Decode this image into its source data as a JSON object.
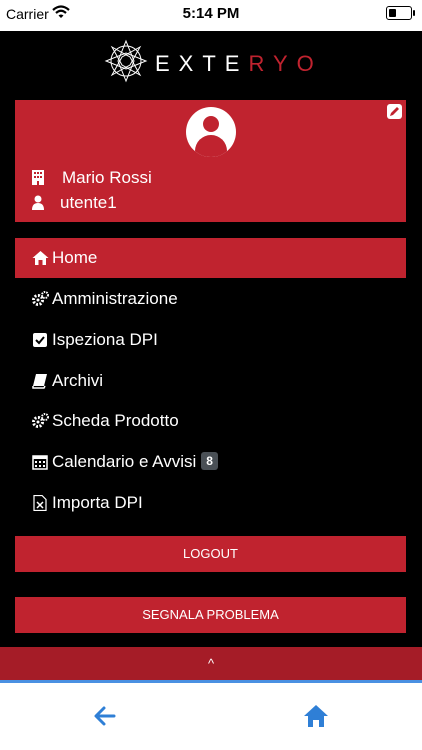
{
  "status_bar": {
    "carrier": "Carrier",
    "time": "5:14 PM",
    "battery_level": 0.35
  },
  "logo": {
    "text_white": "EXTE",
    "text_red": "RYO"
  },
  "profile": {
    "name": "Mario Rossi",
    "username": "utente1"
  },
  "menu": [
    {
      "label": "Home",
      "icon": "home-icon",
      "active": true
    },
    {
      "label": "Amministrazione",
      "icon": "cogs-icon"
    },
    {
      "label": "Ispeziona DPI",
      "icon": "check-square-icon"
    },
    {
      "label": "Archivi",
      "icon": "book-icon"
    },
    {
      "label": "Scheda Prodotto",
      "icon": "cogs-icon"
    },
    {
      "label": "Calendario e Avvisi",
      "icon": "calendar-icon",
      "badge": "8"
    },
    {
      "label": "Importa DPI",
      "icon": "excel-file-icon"
    }
  ],
  "buttons": {
    "logout": "LOGOUT",
    "report": "SEGNALA PROBLEMA"
  },
  "collapse": {
    "icon": "chevron-up-icon",
    "glyph": "^"
  },
  "colors": {
    "accent": "#c0232f",
    "dark_accent": "#a51c27",
    "nav_blue": "#2f7fd6"
  }
}
